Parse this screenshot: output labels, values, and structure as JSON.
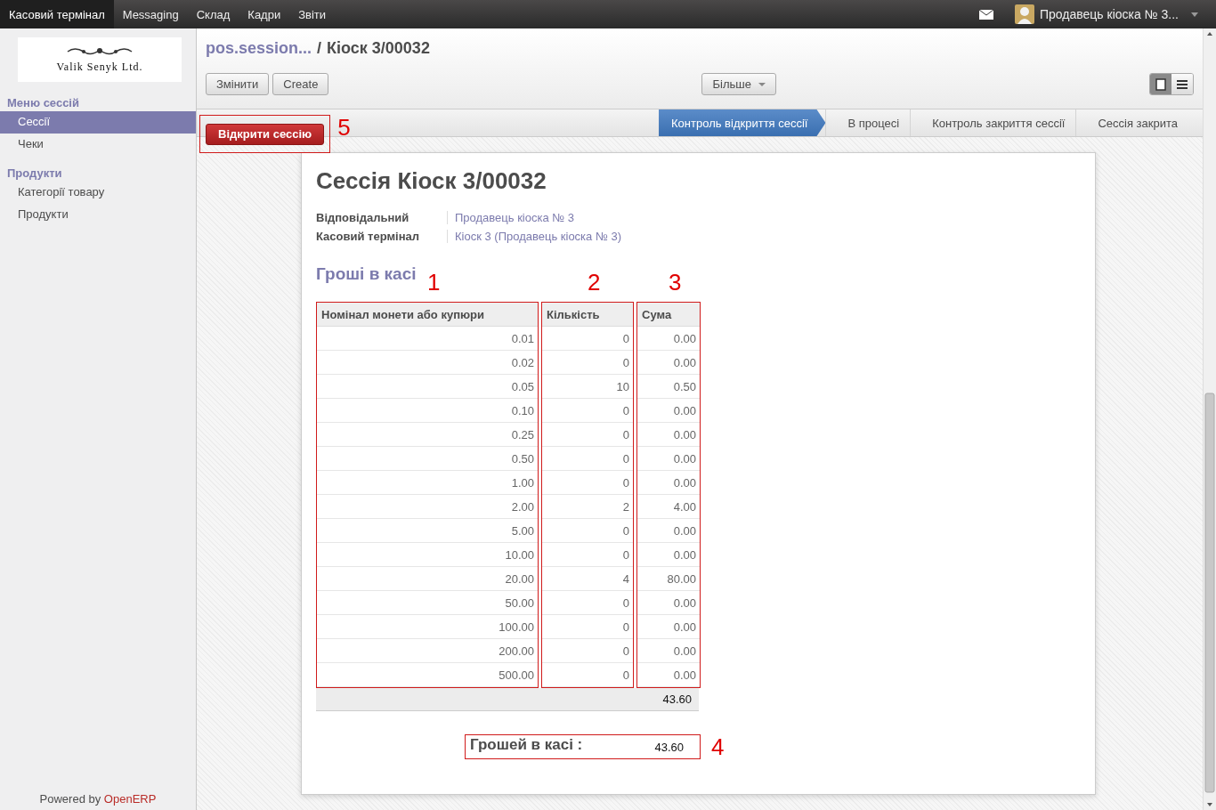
{
  "top_menu": [
    {
      "label": "Касовий термінал",
      "selected": true
    },
    {
      "label": "Messaging",
      "selected": false
    },
    {
      "label": "Склад",
      "selected": false
    },
    {
      "label": "Кадри",
      "selected": false
    },
    {
      "label": "Звіти",
      "selected": false
    }
  ],
  "user": {
    "name": "Продавець кіоска № 3..."
  },
  "sidebar": {
    "logo_text": "Valik Senyk Ltd.",
    "sections": [
      {
        "title": "Меню сессій",
        "items": [
          {
            "label": "Сессії",
            "selected": true
          },
          {
            "label": "Чеки",
            "selected": false
          }
        ]
      },
      {
        "title": "Продукти",
        "items": [
          {
            "label": "Категорії товару",
            "selected": false
          },
          {
            "label": "Продукти",
            "selected": false
          }
        ]
      }
    ],
    "footer": {
      "prefix": "Powered by",
      "brand": "OpenERP"
    }
  },
  "breadcrumb": {
    "parent": "pos.session...",
    "separator": "/",
    "current": "Кіоск 3/00032"
  },
  "toolbar": {
    "buttons": [
      "Змінити",
      "Create"
    ],
    "more": "Більше",
    "view_modes": [
      {
        "kind": "form",
        "selected": true
      },
      {
        "kind": "list",
        "selected": false
      }
    ]
  },
  "action": {
    "label": "Відкрити сессію",
    "annotation": "5"
  },
  "statusbar": [
    {
      "label": "Контроль відкриття сессії",
      "selected": true
    },
    {
      "label": "В процесі",
      "selected": false
    },
    {
      "label": "Контроль закриття сессії",
      "selected": false
    },
    {
      "label": "Сессія закрита",
      "selected": false
    }
  ],
  "form": {
    "title": "Сессія Кіоск 3/00032",
    "fields": [
      {
        "label": "Відповідальний",
        "value": "Продавець кіоска № 3"
      },
      {
        "label": "Касовий термінал",
        "value": "Кіоск 3 (Продавець кіоска № 3)"
      }
    ],
    "section_title": "Гроші в касі",
    "cash_table": {
      "columns": [
        {
          "label": "Номінал монети або купюри",
          "annotation": "1"
        },
        {
          "label": "Кількість",
          "annotation": "2"
        },
        {
          "label": "Сума",
          "annotation": "3"
        }
      ],
      "rows": [
        [
          "0.01",
          "0",
          "0.00"
        ],
        [
          "0.02",
          "0",
          "0.00"
        ],
        [
          "0.05",
          "10",
          "0.50"
        ],
        [
          "0.10",
          "0",
          "0.00"
        ],
        [
          "0.25",
          "0",
          "0.00"
        ],
        [
          "0.50",
          "0",
          "0.00"
        ],
        [
          "1.00",
          "0",
          "0.00"
        ],
        [
          "2.00",
          "2",
          "4.00"
        ],
        [
          "5.00",
          "0",
          "0.00"
        ],
        [
          "10.00",
          "0",
          "0.00"
        ],
        [
          "20.00",
          "4",
          "80.00"
        ],
        [
          "50.00",
          "0",
          "0.00"
        ],
        [
          "100.00",
          "0",
          "0.00"
        ],
        [
          "200.00",
          "0",
          "0.00"
        ],
        [
          "500.00",
          "0",
          "0.00"
        ]
      ],
      "total": "43.60"
    },
    "summary": {
      "label": "Грошей в касі :",
      "value": "43.60",
      "annotation": "4"
    }
  }
}
